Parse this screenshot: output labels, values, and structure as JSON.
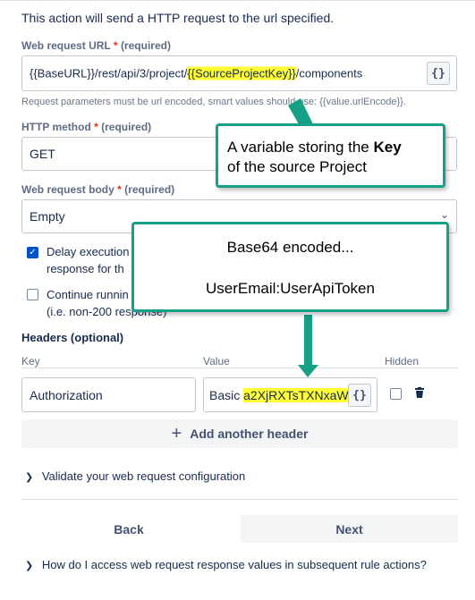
{
  "intro": "This action will send a HTTP request to the url specified.",
  "url": {
    "label": "Web request URL",
    "star": "*",
    "required": "(required)",
    "value_prefix": "{{BaseURL}}/rest/api/3/project/",
    "value_highlight": "{{SourceProjectKey}}",
    "value_suffix": "/components",
    "smart_button": "{}",
    "helper": "Request parameters must be url encoded, smart values should use: {{value.urlEncode}}."
  },
  "method": {
    "label": "HTTP method",
    "star": "*",
    "required": "(required)",
    "value": "GET"
  },
  "body": {
    "label": "Web request body",
    "star": "*",
    "required": "(required)",
    "value": "Empty"
  },
  "options": {
    "delay_line1": "Delay execution",
    "delay_line2": "response for th",
    "continue_line1": "Continue runnin",
    "continue_line2": "(i.e. non-200 response)"
  },
  "headers": {
    "title": "Headers (optional)",
    "col_key": "Key",
    "col_value": "Value",
    "col_hidden": "Hidden",
    "row_key": "Authorization",
    "row_value_prefix": "Basic ",
    "row_value_highlight": "a2XjRXTsTXNxaWF",
    "smart_button": "{}",
    "add_label": "Add another header"
  },
  "validate": "Validate your web request configuration",
  "buttons": {
    "back": "Back",
    "next": "Next"
  },
  "faq": "How do I access web request response values in subsequent rule actions?",
  "annotations": {
    "key_line1_prefix": "A variable storing the  ",
    "key_line1_bold": "Key",
    "key_line2": "of the source Project",
    "base64_line1": "Base64 encoded...",
    "base64_line2": "UserEmail:UserApiToken"
  },
  "colors": {
    "accent": "#0052cc",
    "highlight": "#ffff33",
    "callout_border": "#16a085"
  }
}
